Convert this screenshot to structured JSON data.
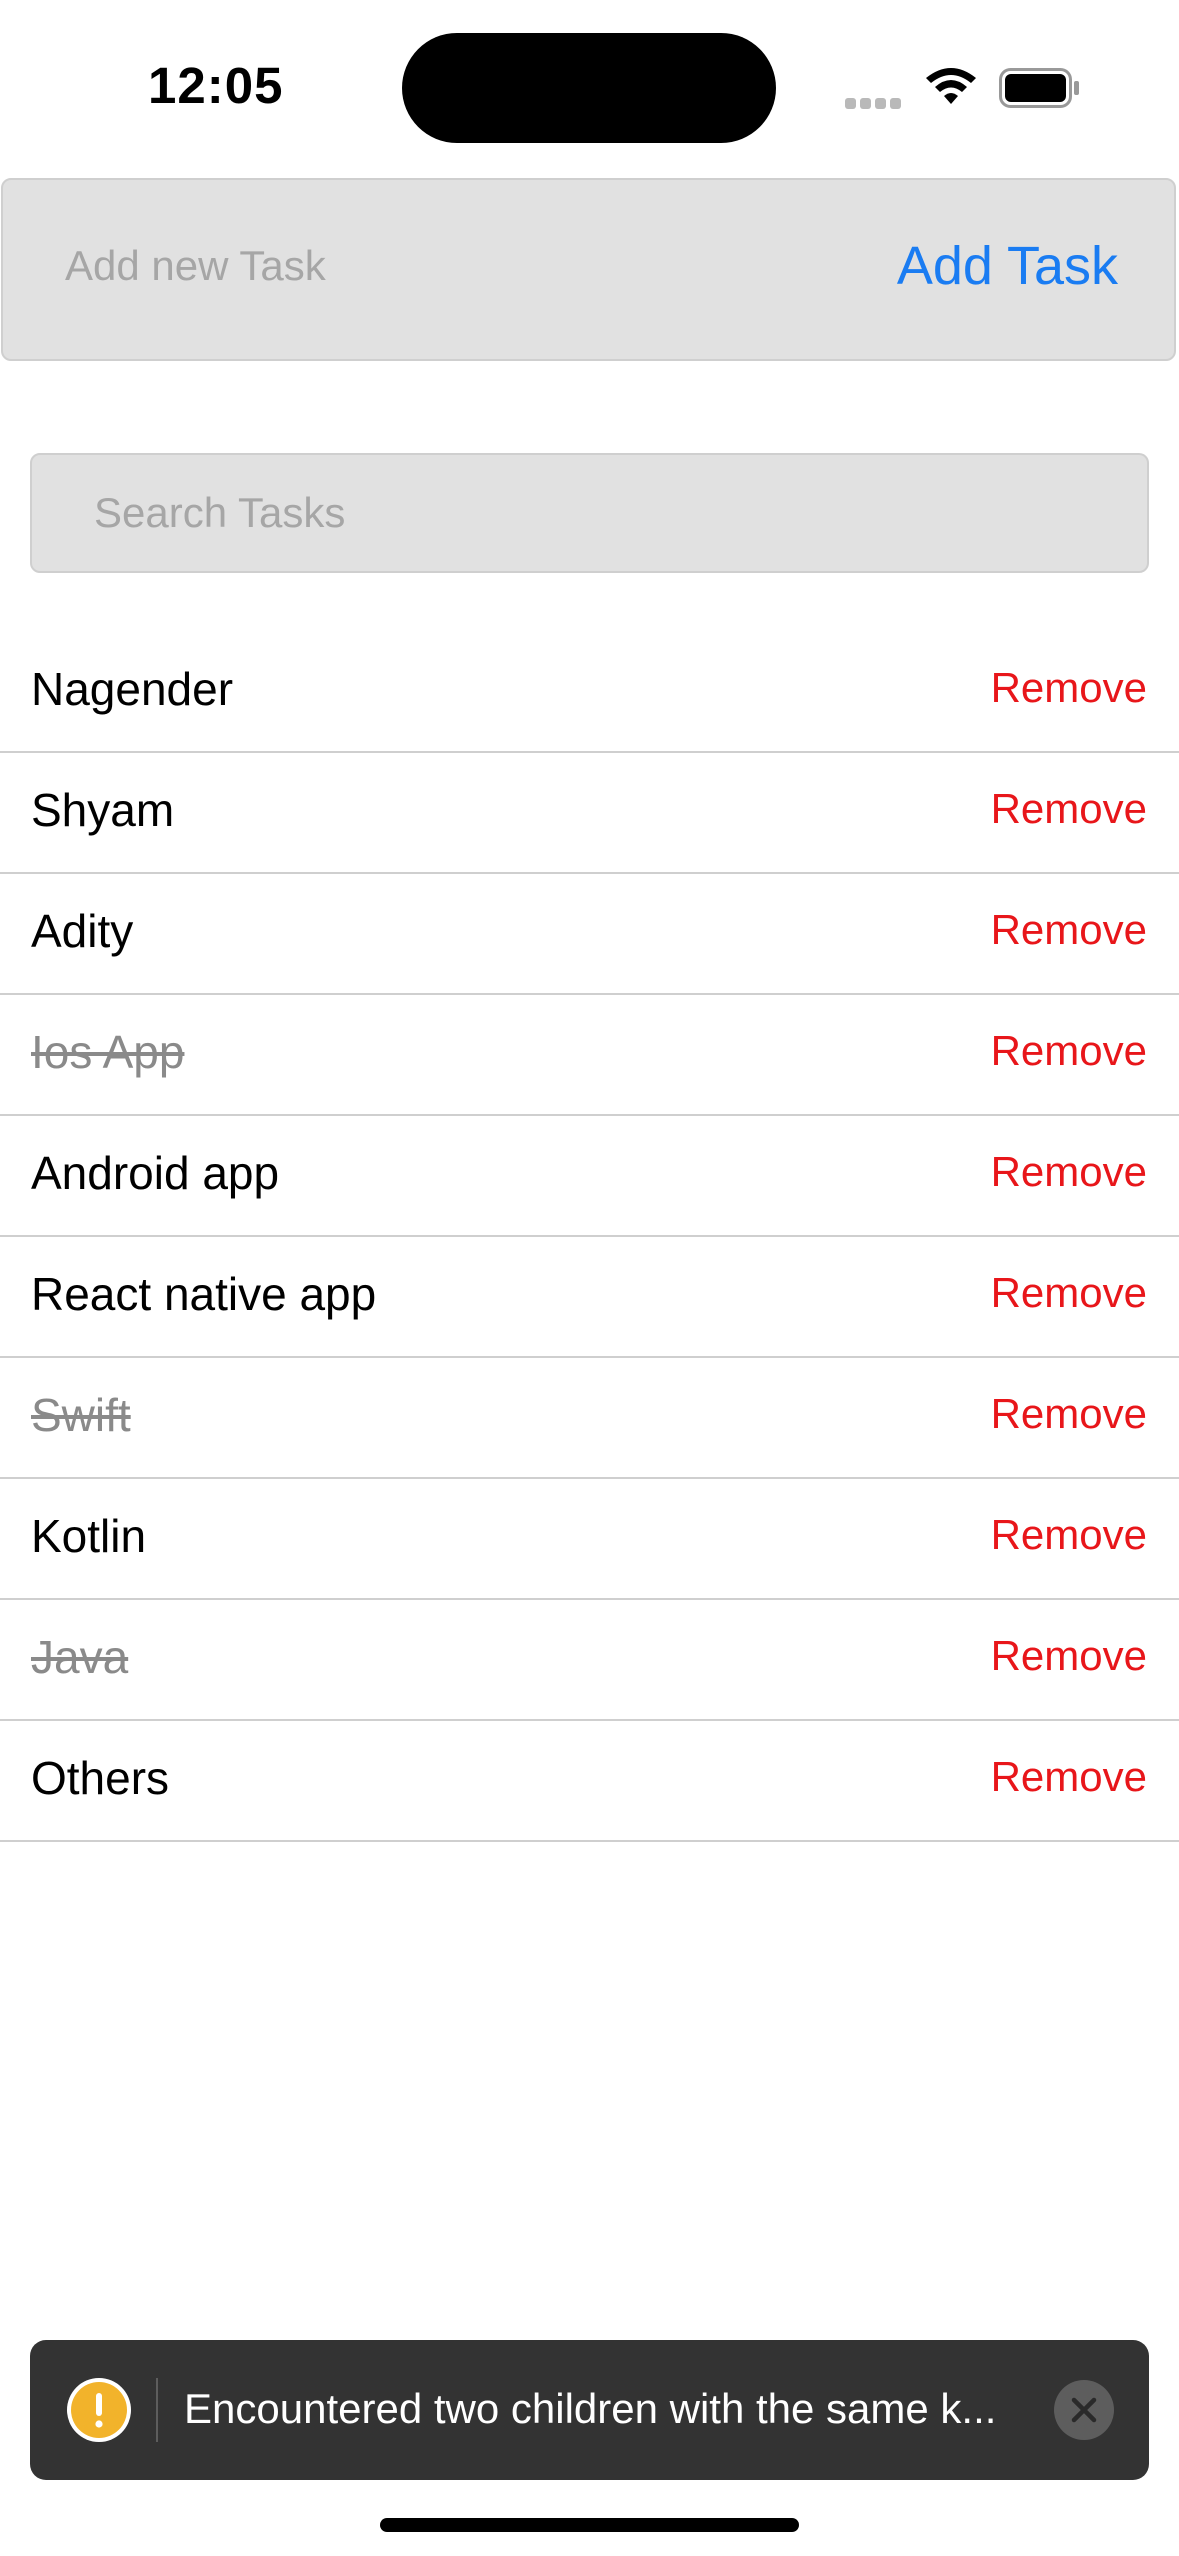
{
  "status_bar": {
    "time": "12:05"
  },
  "add_task": {
    "placeholder": "Add new Task",
    "button_label": "Add Task",
    "accent_color": "#1a7cf2"
  },
  "search": {
    "placeholder": "Search Tasks"
  },
  "tasks": [
    {
      "label": "Nagender",
      "completed": false,
      "action": "Remove"
    },
    {
      "label": "Shyam",
      "completed": false,
      "action": "Remove"
    },
    {
      "label": "Adity",
      "completed": false,
      "action": "Remove"
    },
    {
      "label": "Ios App",
      "completed": true,
      "action": "Remove"
    },
    {
      "label": "Android app",
      "completed": false,
      "action": "Remove"
    },
    {
      "label": "React native app",
      "completed": false,
      "action": "Remove"
    },
    {
      "label": "Swift",
      "completed": true,
      "action": "Remove"
    },
    {
      "label": "Kotlin",
      "completed": false,
      "action": "Remove"
    },
    {
      "label": "Java",
      "completed": true,
      "action": "Remove"
    },
    {
      "label": "Others",
      "completed": false,
      "action": "Remove"
    }
  ],
  "toast": {
    "icon": "warning-icon",
    "message": "Encountered two children with the same k...",
    "close_icon": "close-icon"
  },
  "colors": {
    "remove": "#e8161a",
    "completed_text": "#8a8a8a",
    "toast_bg": "#333333",
    "warning": "#f2b32b"
  }
}
